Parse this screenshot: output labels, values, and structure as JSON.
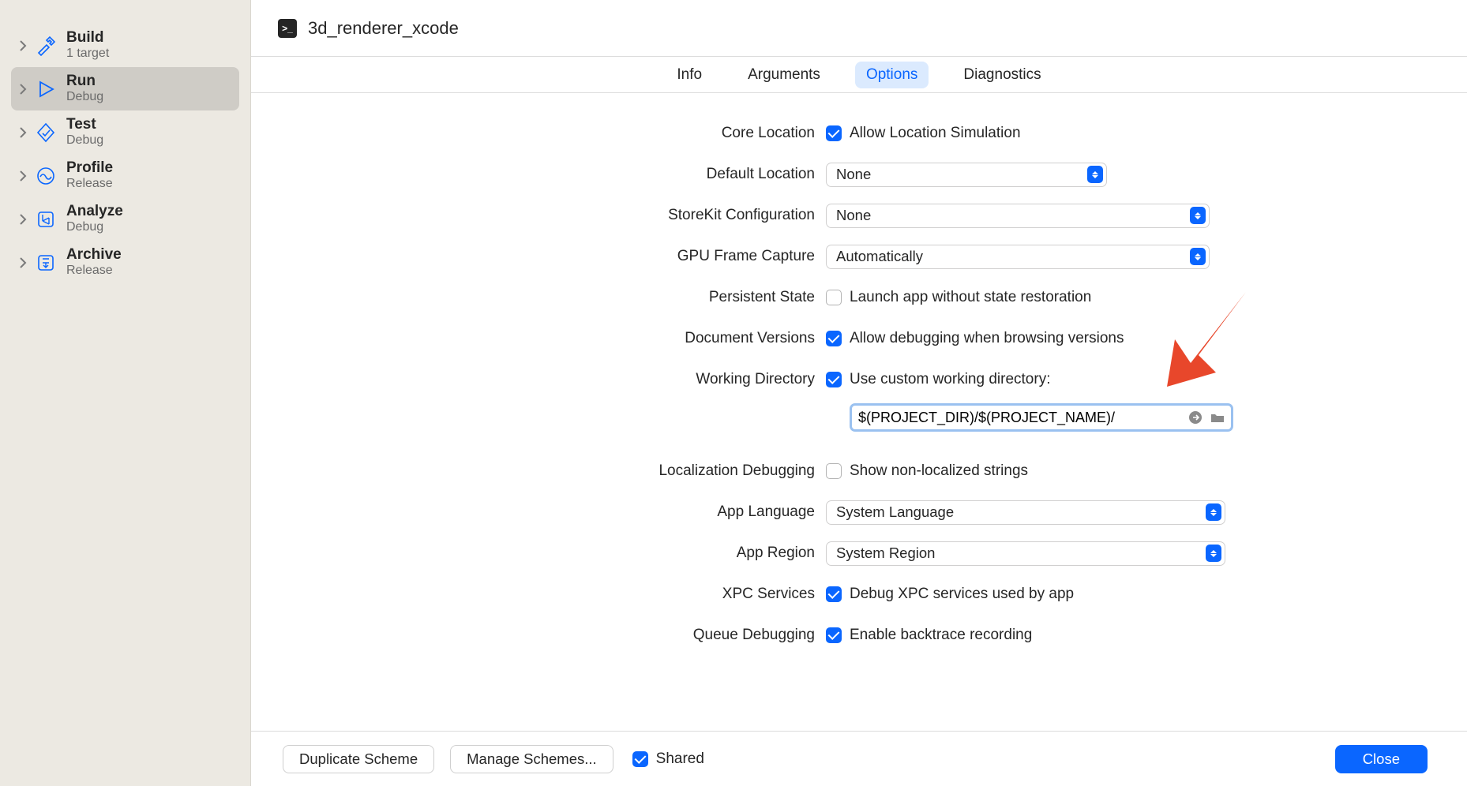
{
  "header": {
    "scheme_name": "3d_renderer_xcode"
  },
  "sidebar": [
    {
      "title": "Build",
      "subtitle": "1 target",
      "icon": "hammer"
    },
    {
      "title": "Run",
      "subtitle": "Debug",
      "icon": "play",
      "selected": true
    },
    {
      "title": "Test",
      "subtitle": "Debug",
      "icon": "test"
    },
    {
      "title": "Profile",
      "subtitle": "Release",
      "icon": "profile"
    },
    {
      "title": "Analyze",
      "subtitle": "Debug",
      "icon": "analyze"
    },
    {
      "title": "Archive",
      "subtitle": "Release",
      "icon": "archive"
    }
  ],
  "tabs": {
    "items": [
      "Info",
      "Arguments",
      "Options",
      "Diagnostics"
    ],
    "active": "Options"
  },
  "options": {
    "core_location_label": "Core Location",
    "core_location_check": "Allow Location Simulation",
    "default_location_label": "Default Location",
    "default_location_value": "None",
    "storekit_label": "StoreKit Configuration",
    "storekit_value": "None",
    "gpu_label": "GPU Frame Capture",
    "gpu_value": "Automatically",
    "persistent_label": "Persistent State",
    "persistent_check": "Launch app without state restoration",
    "docver_label": "Document Versions",
    "docver_check": "Allow debugging when browsing versions",
    "wd_label": "Working Directory",
    "wd_check": "Use custom working directory:",
    "wd_value": "$(PROJECT_DIR)/$(PROJECT_NAME)/",
    "locdbg_label": "Localization Debugging",
    "locdbg_check": "Show non-localized strings",
    "applang_label": "App Language",
    "applang_value": "System Language",
    "appregion_label": "App Region",
    "appregion_value": "System Region",
    "xpc_label": "XPC Services",
    "xpc_check": "Debug XPC services used by app",
    "queue_label": "Queue Debugging",
    "queue_check": "Enable backtrace recording"
  },
  "footer": {
    "duplicate": "Duplicate Scheme",
    "manage": "Manage Schemes...",
    "shared": "Shared",
    "close": "Close"
  }
}
